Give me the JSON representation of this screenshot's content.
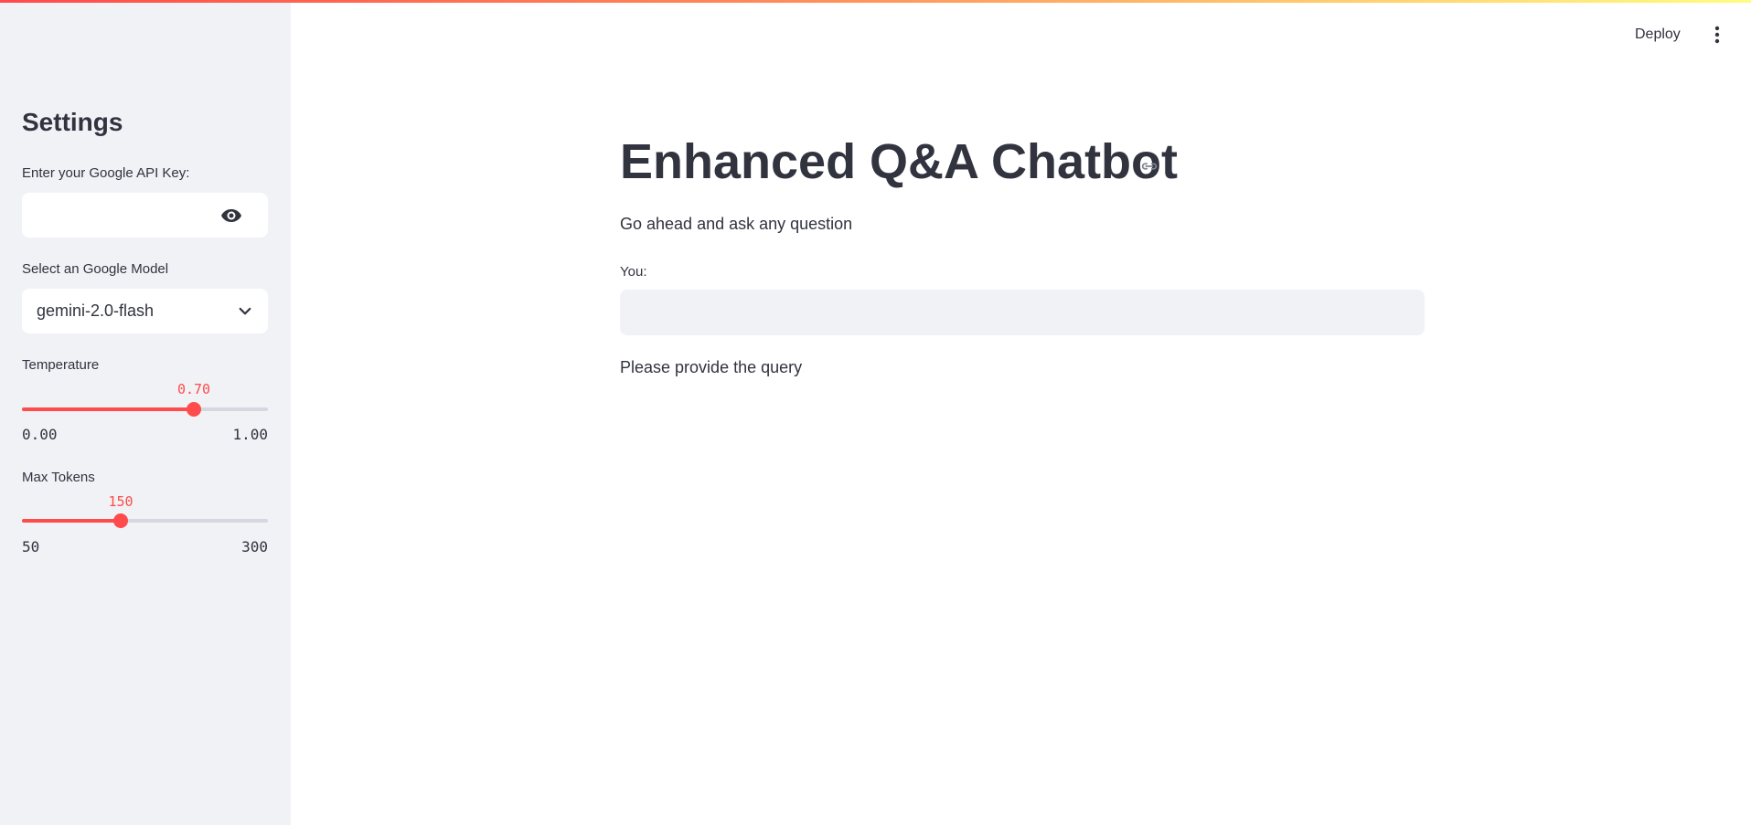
{
  "header": {
    "deploy_label": "Deploy",
    "menu_icon": "kebab-menu-icon"
  },
  "sidebar": {
    "title": "Settings",
    "api_key": {
      "label": "Enter your Google API Key:",
      "value": "",
      "toggle_icon": "eye-icon"
    },
    "model_select": {
      "label": "Select an Google Model",
      "selected": "gemini-2.0-flash",
      "icon": "chevron-down-icon"
    },
    "temperature": {
      "label": "Temperature",
      "value": "0.70",
      "min": "0.00",
      "max": "1.00",
      "fraction": 0.7
    },
    "max_tokens": {
      "label": "Max Tokens",
      "value": "150",
      "min": "50",
      "max": "300",
      "fraction": 0.4
    }
  },
  "main": {
    "title": "Enhanced Q&A Chatbot",
    "anchor_icon": "link-icon",
    "subtitle": "Go ahead and ask any question",
    "input_label": "You:",
    "input_value": "",
    "status": "Please provide the query"
  },
  "colors": {
    "accent": "#ff4b4b",
    "sidebar_bg": "#f0f2f6",
    "text": "#31333f"
  }
}
